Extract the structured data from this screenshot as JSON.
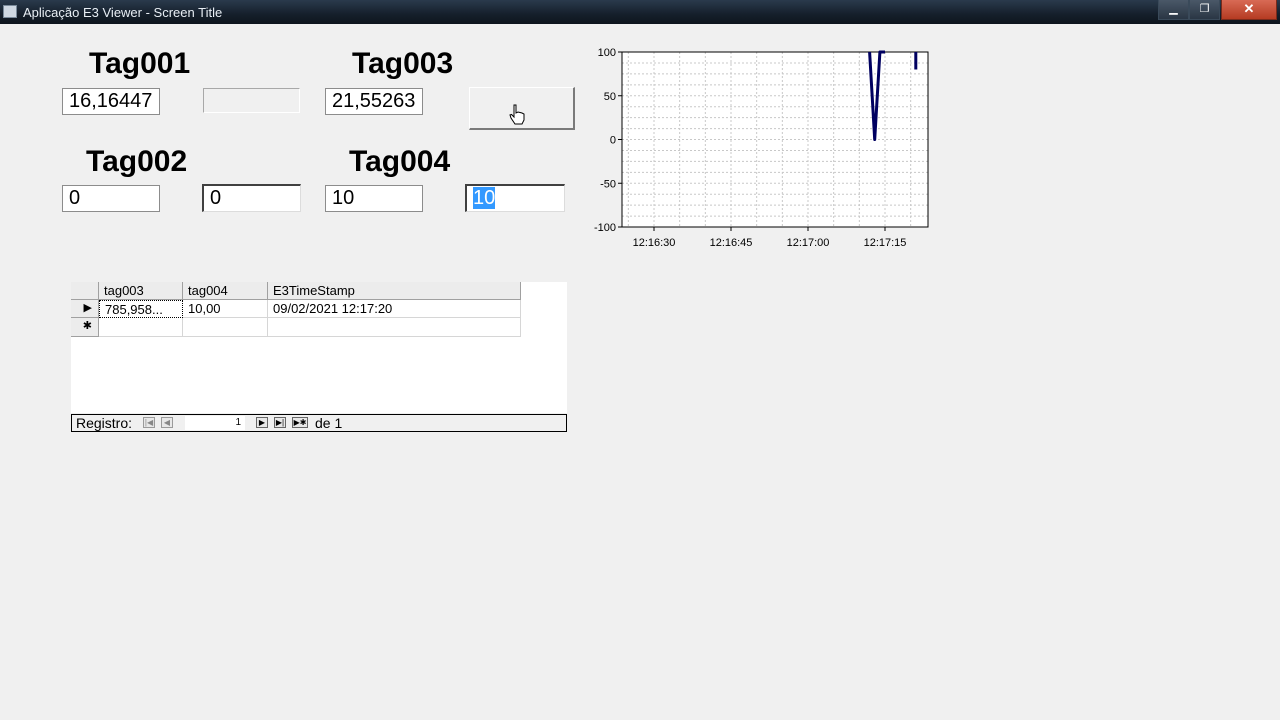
{
  "window": {
    "title": "Aplicação E3 Viewer - Screen Title",
    "minimize": "▁",
    "maximize": "❐",
    "close": "✕"
  },
  "tags": {
    "tag001": {
      "label": "Tag001",
      "value": "16,16447"
    },
    "tag002": {
      "label": "Tag002",
      "value": "0",
      "input": "0"
    },
    "tag003": {
      "label": "Tag003",
      "value": "21,55263"
    },
    "tag004": {
      "label": "Tag004",
      "value": "10",
      "input": "10"
    }
  },
  "grid": {
    "columns": [
      "tag003",
      "tag004",
      "E3TimeStamp"
    ],
    "rows": [
      [
        "785,958...",
        "10,00",
        "09/02/2021 12:17:20"
      ]
    ],
    "new_row_marker": "✱",
    "current_row_marker": "▶"
  },
  "navigator": {
    "label": "Registro:",
    "current": "1",
    "of_label": "de 1"
  },
  "chart_data": {
    "type": "line",
    "ylim": [
      -100,
      100
    ],
    "y_ticks": [
      100,
      50,
      0,
      -50,
      -100
    ],
    "x_tick_labels": [
      "12:16:30",
      "12:16:45",
      "12:17:00",
      "12:17:15"
    ],
    "grid": true,
    "series": [
      {
        "color": "#000060",
        "x": [
          "12:17:12",
          "12:17:13",
          "12:17:14",
          "12:17:15"
        ],
        "values": [
          100,
          0,
          100,
          100
        ]
      },
      {
        "color": "#000060",
        "x": [
          "12:17:21",
          "12:17:21"
        ],
        "values": [
          100,
          80
        ]
      }
    ]
  }
}
